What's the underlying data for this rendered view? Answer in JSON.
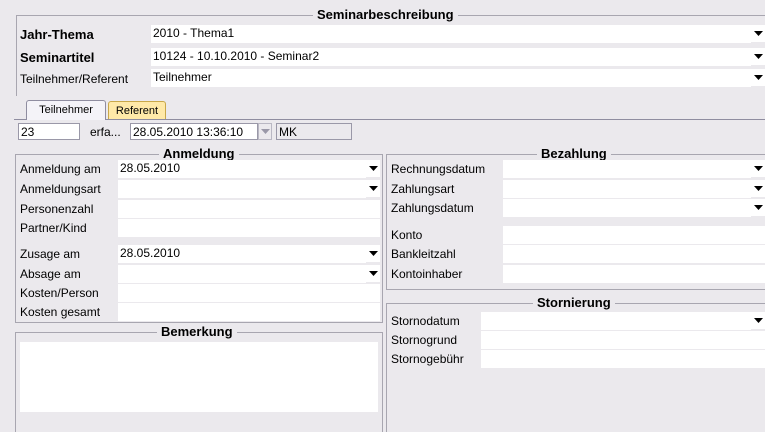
{
  "header": {
    "title": "Seminarbeschreibung",
    "rows": [
      {
        "label": "Jahr-Thema",
        "value": "2010 - Thema1"
      },
      {
        "label": "Seminartitel",
        "value": "10124 - 10.10.2010 - Seminar2"
      },
      {
        "label": "Teilnehmer/Referent",
        "value": "Teilnehmer"
      }
    ]
  },
  "tabs": [
    {
      "label": "Teilnehmer",
      "active": true
    },
    {
      "label": "Referent",
      "active": false
    }
  ],
  "record": {
    "id": "23",
    "created_label": "erfa...",
    "created_value": "28.05.2010 13:36:10",
    "user": "MK"
  },
  "anmeldung": {
    "title": "Anmeldung",
    "rows": [
      {
        "label": "Anmeldung am",
        "value": "28.05.2010",
        "dropdown": true
      },
      {
        "label": "Anmeldungsart",
        "value": "",
        "dropdown": true
      },
      {
        "label": "Personenzahl",
        "value": "",
        "dropdown": false
      },
      {
        "label": "Partner/Kind",
        "value": "",
        "dropdown": false
      },
      {
        "label": "Zusage am",
        "value": "28.05.2010",
        "dropdown": true
      },
      {
        "label": "Absage am",
        "value": "",
        "dropdown": true
      },
      {
        "label": "Kosten/Person",
        "value": "",
        "dropdown": false
      },
      {
        "label": "Kosten gesamt",
        "value": "",
        "dropdown": false
      }
    ]
  },
  "bemerkung": {
    "title": "Bemerkung",
    "value": ""
  },
  "bezahlung": {
    "title": "Bezahlung",
    "rows": [
      {
        "label": "Rechnungsdatum",
        "value": "",
        "dropdown": true
      },
      {
        "label": "Zahlungsart",
        "value": "",
        "dropdown": true
      },
      {
        "label": "Zahlungsdatum",
        "value": "",
        "dropdown": true
      },
      {
        "label": "Konto",
        "value": "",
        "dropdown": false
      },
      {
        "label": "Bankleitzahl",
        "value": "",
        "dropdown": false
      },
      {
        "label": "Kontoinhaber",
        "value": "",
        "dropdown": false
      }
    ]
  },
  "stornierung": {
    "title": "Stornierung",
    "rows": [
      {
        "label": "Stornodatum",
        "value": "",
        "dropdown": true
      },
      {
        "label": "Stornogrund",
        "value": "",
        "dropdown": false
      },
      {
        "label": "Stornogebühr",
        "value": "",
        "dropdown": false
      }
    ]
  },
  "colors": {
    "tab_active": "#f4f3f8",
    "tab_inactive": "#ffe9a8",
    "background": "#ebe9ed",
    "line": "#a8a6b0"
  },
  "icons": {
    "dropdown": "chevron-down-icon"
  }
}
